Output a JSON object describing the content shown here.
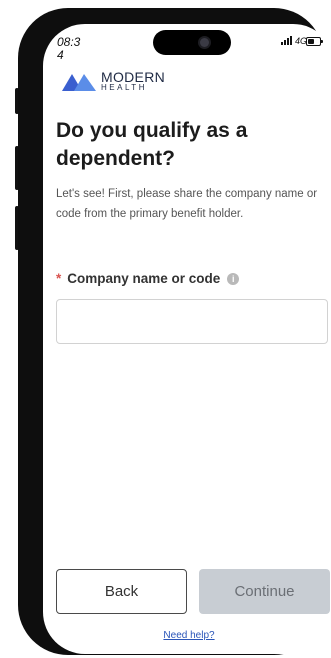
{
  "status_bar": {
    "time": "08:34",
    "network": "4G"
  },
  "brand": {
    "name_line1": "MODERN",
    "name_line2": "HEALTH",
    "colors": [
      "#3a5fcf",
      "#5b8de8"
    ]
  },
  "page": {
    "title": "Do you qualify as a dependent?",
    "subtitle": "Let's see! First, please share the company name or code from the primary benefit holder."
  },
  "form": {
    "required_marker": "*",
    "field_label": "Company name or code",
    "info_icon": "i",
    "company_value": ""
  },
  "actions": {
    "back_label": "Back",
    "continue_label": "Continue",
    "help_link": "Need help?"
  }
}
